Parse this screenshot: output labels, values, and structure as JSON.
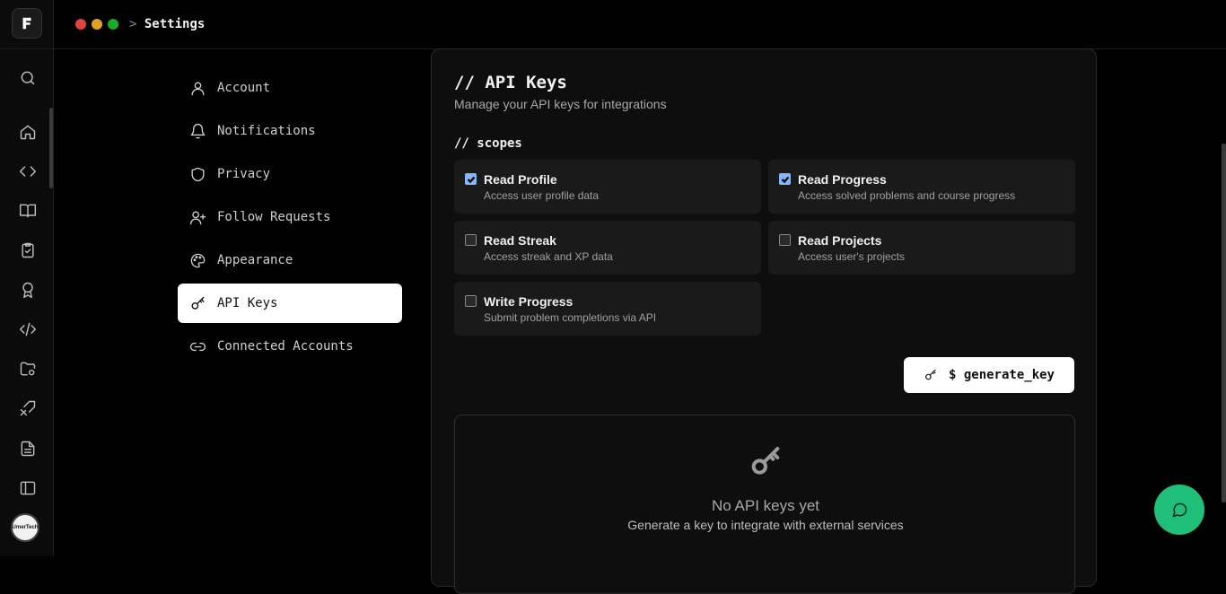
{
  "window": {
    "controls": [
      "close",
      "minimize",
      "maximize"
    ],
    "colors": {
      "close": "#e0443e",
      "minimize": "#dea123",
      "maximize": "#1aab29"
    }
  },
  "breadcrumb": {
    "separator": ">",
    "current": "Settings"
  },
  "rail": {
    "icons": [
      "search-icon",
      "home-icon",
      "code-icon",
      "book-icon",
      "clipboard-check-icon",
      "award-icon",
      "code-brackets-icon",
      "folder-cog-icon",
      "swords-icon",
      "document-icon",
      "sidebar-icon"
    ],
    "avatar_text": "UmerTech"
  },
  "settings_nav": {
    "items": [
      {
        "label": "Account",
        "icon": "user-icon",
        "active": false
      },
      {
        "label": "Notifications",
        "icon": "bell-icon",
        "active": false
      },
      {
        "label": "Privacy",
        "icon": "shield-icon",
        "active": false
      },
      {
        "label": "Follow Requests",
        "icon": "user-plus-icon",
        "active": false
      },
      {
        "label": "Appearance",
        "icon": "palette-icon",
        "active": false
      },
      {
        "label": "API Keys",
        "icon": "key-icon",
        "active": true
      },
      {
        "label": "Connected Accounts",
        "icon": "link-icon",
        "active": false
      }
    ]
  },
  "panel": {
    "title": "// API Keys",
    "subtitle": "Manage your API keys for integrations",
    "scopes_heading": "// scopes",
    "scopes": [
      {
        "title": "Read Profile",
        "description": "Access user profile data",
        "checked": true
      },
      {
        "title": "Read Progress",
        "description": "Access solved problems and course progress",
        "checked": true
      },
      {
        "title": "Read Streak",
        "description": "Access streak and XP data",
        "checked": false
      },
      {
        "title": "Read Projects",
        "description": "Access user's projects",
        "checked": false
      },
      {
        "title": "Write Progress",
        "description": "Submit problem completions via API",
        "checked": false
      }
    ],
    "generate_button": "$ generate_key",
    "empty_state": {
      "title": "No API keys yet",
      "description": "Generate a key to integrate with external services"
    }
  },
  "accent": {
    "chat_button": "#1fbf7a",
    "checkbox": "#8ab4f8"
  }
}
